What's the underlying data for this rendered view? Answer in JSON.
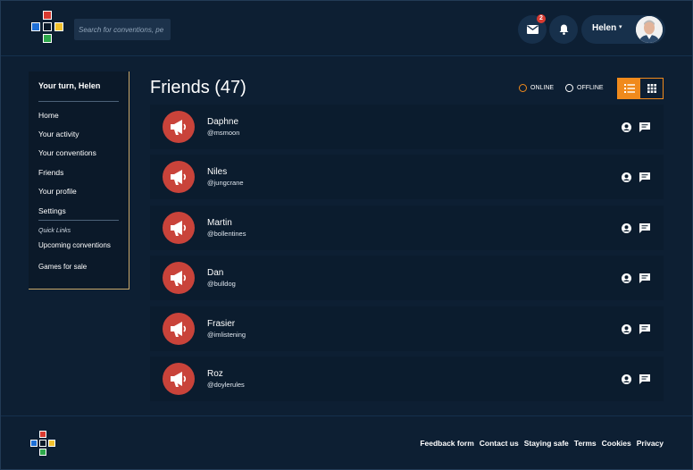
{
  "brand": {
    "logo_colors": {
      "top": "#d93b31",
      "left": "#1f6fd6",
      "center": "#0b1929",
      "right": "#f2c12e",
      "bottom": "#2ea84b"
    }
  },
  "header": {
    "search_placeholder": "Search for conventions, pe",
    "mail_badge": "2",
    "user_name": "Helen",
    "caret": "▾"
  },
  "sidebar": {
    "title": "Your turn, Helen",
    "nav": [
      "Home",
      "Your activity",
      "Your conventions",
      "Friends",
      "Your profile",
      "Settings"
    ],
    "quick_links_label": "Quick Links",
    "quick_links": [
      "Upcoming conventions",
      "Games for sale"
    ]
  },
  "main": {
    "title": "Friends (47)",
    "filter_online": "ONLINE",
    "filter_offline": "OFFLINE",
    "accent": "#f08a1c"
  },
  "friends": [
    {
      "name": "Daphne",
      "handle": "@msmoon"
    },
    {
      "name": "Niles",
      "handle": "@jungcrane"
    },
    {
      "name": "Martin",
      "handle": "@bollentines"
    },
    {
      "name": "Dan",
      "handle": "@bulldog"
    },
    {
      "name": "Frasier",
      "handle": "@imlistening"
    },
    {
      "name": "Roz",
      "handle": "@doylerules"
    }
  ],
  "footer": {
    "links": [
      "Feedback form",
      "Contact us",
      "Staying safe",
      "Terms",
      "Cookies",
      "Privacy"
    ]
  },
  "icons": {
    "mail": "mail-icon",
    "bell": "bell-icon",
    "list": "list-view-icon",
    "grid": "grid-view-icon",
    "megaphone": "megaphone-icon",
    "profile": "profile-icon",
    "message": "message-icon"
  }
}
